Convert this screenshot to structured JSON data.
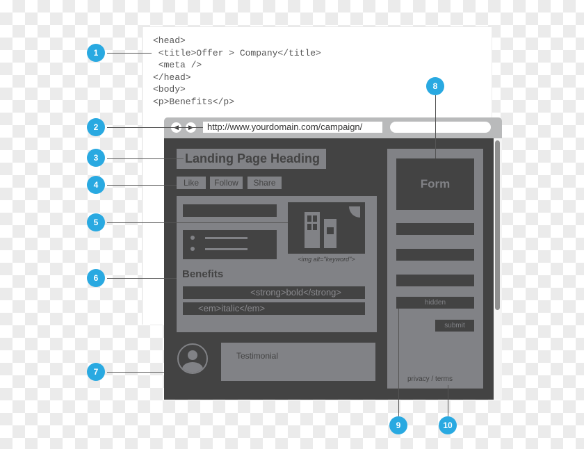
{
  "code_snippet": {
    "lines": [
      "<head>",
      " <title>Offer > Company</title>",
      " <meta />",
      "</head>",
      "<body>",
      "<p>Benefits</p>"
    ]
  },
  "browser": {
    "url": "http://www.yourdomain.com/campaign/",
    "back_icon": "arrow-left",
    "forward_icon": "arrow-right"
  },
  "landing_page": {
    "heading": "Landing Page Heading",
    "social_buttons": [
      "Like",
      "Follow",
      "Share"
    ],
    "image_caption": "<img alt=\"keyword\">",
    "benefits_title": "Benefits",
    "strong_text": "<strong>bold</strong>",
    "em_text": "<em>italic</em>",
    "testimonial": "Testimonial"
  },
  "form": {
    "title": "Form",
    "hidden_label": "hidden",
    "submit_label": "submit",
    "privacy_link": "privacy / terms"
  },
  "callouts": [
    "1",
    "2",
    "3",
    "4",
    "5",
    "6",
    "7",
    "8",
    "9",
    "10"
  ],
  "colors": {
    "callout": "#29a9e1",
    "dark": "#434343",
    "mid_grey": "#818286"
  }
}
